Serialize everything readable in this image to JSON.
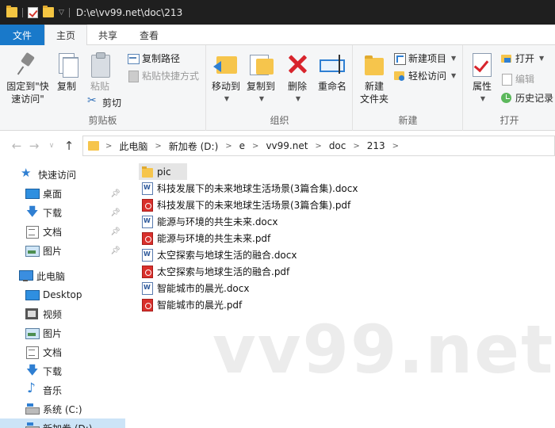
{
  "titlebar": {
    "path": "D:\\e\\vv99.net\\doc\\213"
  },
  "tabs": [
    {
      "label": "文件"
    },
    {
      "label": "主页"
    },
    {
      "label": "共享"
    },
    {
      "label": "查看"
    }
  ],
  "ribbon": {
    "clipboard": {
      "pin_label": "固定到\"快速访问\"",
      "copy_label": "复制",
      "paste_label": "粘贴",
      "copy_path_label": "复制路径",
      "paste_shortcut_label": "粘贴快捷方式",
      "cut_label": "剪切",
      "group_label": "剪贴板"
    },
    "organize": {
      "move_to_label": "移动到",
      "copy_to_label": "复制到",
      "delete_label": "删除",
      "rename_label": "重命名",
      "group_label": "组织"
    },
    "new": {
      "new_folder_label": "新建\n文件夹",
      "new_item_label": "新建项目",
      "easy_access_label": "轻松访问",
      "group_label": "新建"
    },
    "open": {
      "properties_label": "属性",
      "open_label": "打开",
      "edit_label": "编辑",
      "history_label": "历史记录",
      "group_label": "打开"
    }
  },
  "breadcrumb": [
    "此电脑",
    "新加卷 (D:)",
    "e",
    "vv99.net",
    "doc",
    "213"
  ],
  "sidebar": {
    "quick_access": "快速访问",
    "quick_items": [
      {
        "label": "桌面",
        "icon": "desktop-icon"
      },
      {
        "label": "下载",
        "icon": "download-icon"
      },
      {
        "label": "文档",
        "icon": "documents-icon"
      },
      {
        "label": "图片",
        "icon": "pictures-icon"
      }
    ],
    "this_pc": "此电脑",
    "pc_items": [
      {
        "label": "Desktop",
        "icon": "desktop-icon"
      },
      {
        "label": "视频",
        "icon": "video-icon"
      },
      {
        "label": "图片",
        "icon": "pictures-icon"
      },
      {
        "label": "文档",
        "icon": "documents-icon"
      },
      {
        "label": "下载",
        "icon": "download-icon"
      },
      {
        "label": "音乐",
        "icon": "music-icon"
      },
      {
        "label": "系统 (C:)",
        "icon": "drive-icon"
      },
      {
        "label": "新加卷 (D:)",
        "icon": "drive-icon"
      }
    ]
  },
  "files": [
    {
      "name": "pic",
      "type": "folder"
    },
    {
      "name": "科技发展下的未来地球生活场景(3篇合集).docx",
      "type": "word"
    },
    {
      "name": "科技发展下的未来地球生活场景(3篇合集).pdf",
      "type": "pdf"
    },
    {
      "name": "能源与环境的共生未来.docx",
      "type": "word"
    },
    {
      "name": "能源与环境的共生未来.pdf",
      "type": "pdf"
    },
    {
      "name": "太空探索与地球生活的融合.docx",
      "type": "word"
    },
    {
      "name": "太空探索与地球生活的融合.pdf",
      "type": "pdf"
    },
    {
      "name": "智能城市的晨光.docx",
      "type": "word"
    },
    {
      "name": "智能城市的晨光.pdf",
      "type": "pdf"
    }
  ],
  "watermark": "vv99.net",
  "colors": {
    "accent": "#1979ca",
    "titlebar": "#1f1f1f",
    "selection": "#cce4f7"
  }
}
